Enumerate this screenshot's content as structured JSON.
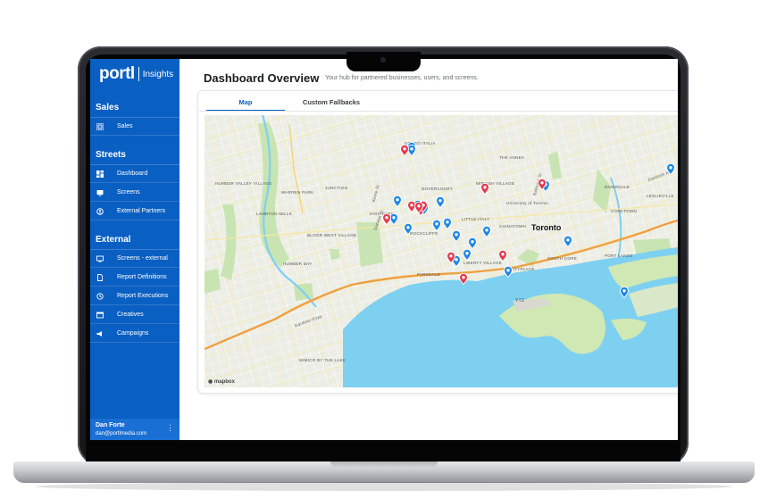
{
  "sidebar": {
    "logo": "portl",
    "logo_sub": "Insights",
    "sections": [
      {
        "title": "Sales",
        "items": [
          {
            "label": "Sales",
            "icon": "grid-icon"
          }
        ]
      },
      {
        "title": "Streets",
        "items": [
          {
            "label": "Dashboard",
            "icon": "dashboard-icon"
          },
          {
            "label": "Screens",
            "icon": "screen-icon"
          },
          {
            "label": "External Partners",
            "icon": "partners-icon"
          }
        ]
      },
      {
        "title": "External",
        "items": [
          {
            "label": "Screens - external",
            "icon": "monitor-icon"
          },
          {
            "label": "Report Definitions",
            "icon": "document-icon"
          },
          {
            "label": "Report Executions",
            "icon": "history-icon"
          },
          {
            "label": "Creatives",
            "icon": "creative-icon"
          },
          {
            "label": "Campaigns",
            "icon": "megaphone-icon"
          }
        ]
      }
    ],
    "user": {
      "name": "Dan Forte",
      "email": "dan@portlmedia.com"
    }
  },
  "header": {
    "title": "Dashboard Overview",
    "subtitle": "Your hub for partnered businesses, users, and screens."
  },
  "tabs": [
    {
      "label": "Map",
      "active": true
    },
    {
      "label": "Custom Fallbacks",
      "active": false
    }
  ],
  "map": {
    "city_label": "Toronto",
    "attribution": "mapbox",
    "labels": {
      "corso_italia": "CORSO ITALIA",
      "the_annex": "THE ANNEX",
      "humber_valley": "HUMBER VALLEY VILLAGE",
      "warren_park": "WARREN PARK",
      "junction": "JUNCTION",
      "dovercourt": "DOVERCOURT",
      "mirvish": "MIRVISH VILLAGE",
      "university": "University of Toronto",
      "riverdale": "RIVERDALE",
      "leslieville": "LESLIEVILLE",
      "lambton_mills": "LAMBTON MILLS",
      "high_park": "HIGH PARK",
      "little_italy": "LITTLE ITALY",
      "chinatown": "CHINATOWN",
      "corktown": "CORKTOWN",
      "bloor_west": "BLOOR WEST VILLAGE",
      "rockcliffe": "ROCKCLIFFE",
      "south_core": "SOUTH CORE",
      "port_lands": "PORT LANDS",
      "humber_bay": "HUMBER BAY",
      "parkdale": "PARKDALE",
      "liberty": "LIBERTY VILLAGE",
      "cityplace": "CITYPLACE",
      "ytz": "YTZ",
      "gardiner": "Gardiner Expy",
      "mimico": "MIMICO BY THE LAKE",
      "danforth": "Danforth Ave",
      "keele": "Keele St",
      "dundas": "Dundas St",
      "bathurst": "Bathurst St"
    },
    "colors": {
      "water": "#7ed0f0",
      "land": "#eef0e8",
      "park": "#cbe6b6",
      "highway": "#f0a040",
      "blue_pin": "#1e88e5",
      "red_pin": "#e53950"
    },
    "blue_pins": 22,
    "red_pins": 11
  }
}
